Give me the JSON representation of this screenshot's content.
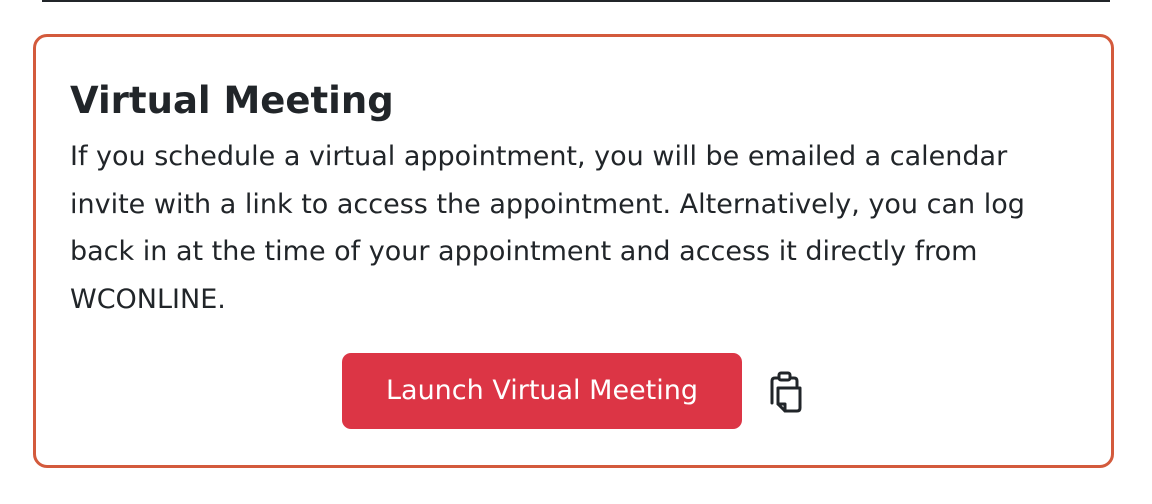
{
  "card": {
    "title": "Virtual Meeting",
    "body": "If you schedule a virtual appointment, you will be emailed a calendar invite with a link to access the appointment. Alternatively, you can log back in at the time of your appointment and access it directly from WCONLINE.",
    "launch_button_label": "Launch Virtual Meeting",
    "copy_icon": "clipboard-copy-icon"
  },
  "colors": {
    "card_border": "#d35a3c",
    "button_background": "#dc3545",
    "button_text": "#ffffff",
    "text": "#212529"
  }
}
